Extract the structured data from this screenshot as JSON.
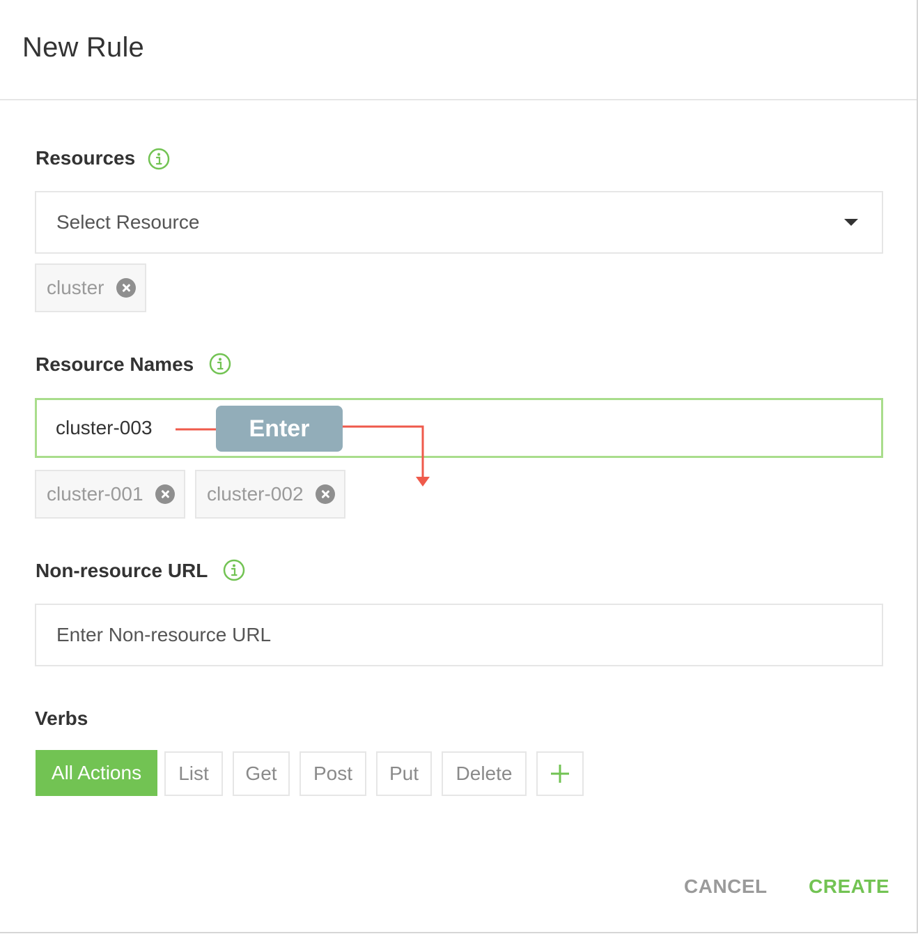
{
  "dialog": {
    "title": "New Rule"
  },
  "resources": {
    "label": "Resources",
    "placeholder": "Select Resource",
    "tags": [
      "cluster"
    ]
  },
  "resource_names": {
    "label": "Resource Names",
    "value": "cluster-003",
    "tags": [
      "cluster-001",
      "cluster-002"
    ]
  },
  "annotation": {
    "badge": "Enter"
  },
  "non_resource_url": {
    "label": "Non-resource URL",
    "placeholder": "Enter Non-resource URL"
  },
  "verbs": {
    "label": "Verbs",
    "items": [
      "All Actions",
      "List",
      "Get",
      "Post",
      "Put",
      "Delete"
    ],
    "selected": "All Actions",
    "add_icon": "plus-icon"
  },
  "footer": {
    "cancel": "CANCEL",
    "create": "CREATE"
  },
  "colors": {
    "accent": "#72c353",
    "info_icon": "#72c353",
    "active_border": "#a9dd8c",
    "annotation_arrow": "#ef5a4b",
    "annotation_badge": "#92adb9"
  }
}
